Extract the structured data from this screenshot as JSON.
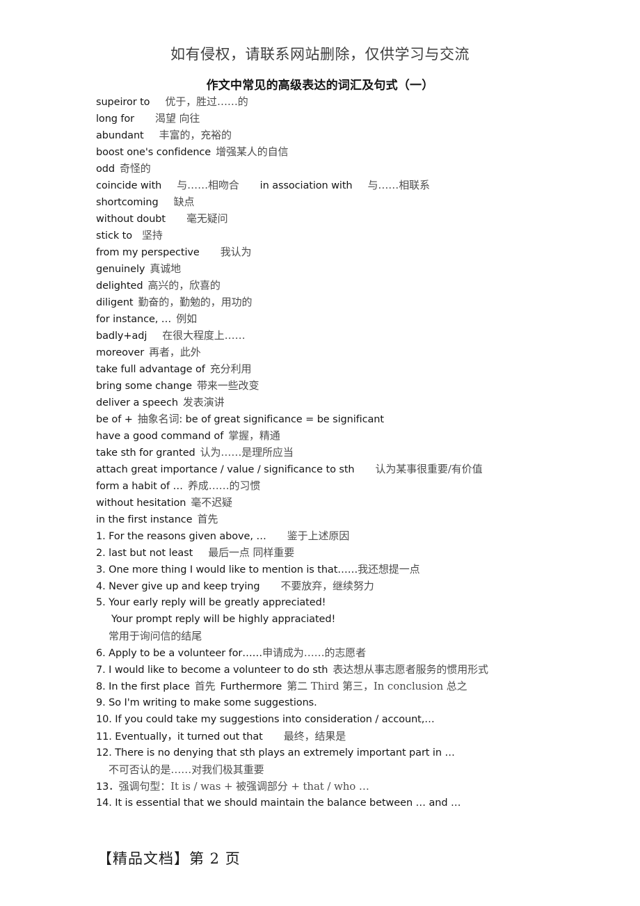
{
  "header": {
    "watermark": "如有侵权，请联系网站删除，仅供学习与交流",
    "title": "作文中常见的高级表达的词汇及句式（一）"
  },
  "footer": {
    "text": "【精品文档】第 2 页",
    "page_number": "2"
  },
  "lines": [
    {
      "en": "supeiror to",
      "gap": "sp3",
      "cn": "优于，胜过……的"
    },
    {
      "en": "long for",
      "gap": "sp4",
      "cn": "渴望   向往"
    },
    {
      "en": "abundant",
      "gap": "sp3",
      "cn": "丰富的，充裕的"
    },
    {
      "en": "boost one's confidence",
      "gap": "sp1",
      "cn": "增强某人的自信"
    },
    {
      "en": "odd",
      "gap": "sp1",
      "cn": "奇怪的"
    },
    {
      "en": "coincide with",
      "gap": "sp3",
      "cn": "与……相吻合",
      "en2": "in association with",
      "gap2": "sp3",
      "cn2": "与……相联系",
      "gapmid": "sp4"
    },
    {
      "en": "shortcoming",
      "gap": "sp3",
      "cn": "缺点"
    },
    {
      "en": "without doubt",
      "gap": "sp4",
      "cn": "毫无疑问"
    },
    {
      "en": "stick   to",
      "gap": "sp2",
      "cn": "坚持"
    },
    {
      "en": "from   my   perspective",
      "gap": "sp4",
      "cn": "我认为"
    },
    {
      "en": "genuinely",
      "gap": "sp1",
      "cn": "真诚地"
    },
    {
      "en": "delighted",
      "gap": "sp1",
      "cn": "高兴的，欣喜的"
    },
    {
      "en": "diligent",
      "gap": "sp1",
      "cn": "勤奋的，勤勉的，用功的"
    },
    {
      "en": "for   instance, …",
      "gap": "sp1",
      "cn": "例如"
    },
    {
      "en": "badly+adj",
      "gap": "sp3",
      "cn": "在很大程度上……"
    },
    {
      "en": "moreover",
      "gap": "sp1",
      "cn": "再者，此外"
    },
    {
      "en": "take   full   advantage   of",
      "gap": "sp1",
      "cn": "充分利用"
    },
    {
      "en": "bring some change",
      "gap": "sp1",
      "cn": "带来一些改变"
    },
    {
      "en": "deliver a speech",
      "gap": "sp1",
      "cn": "发表演讲"
    },
    {
      "en": "be of +",
      "gap": "sp1",
      "cn": "抽象名词",
      "en2": ": be of great significance = be significant",
      "gap2": "",
      "cn2": "",
      "gapmid": ""
    },
    {
      "en": "have a good command of",
      "gap": "sp1",
      "cn": "掌握，精通"
    },
    {
      "en": "take sth for granted",
      "gap": "sp1",
      "cn": "认为……是理所应当"
    },
    {
      "en": "attach great importance / value / significance to sth",
      "gap": "sp4",
      "cn": "认为某事很重要/有价值"
    },
    {
      "en": "form a habit of …",
      "gap": "sp1",
      "cn": "养成……的习惯"
    },
    {
      "en": "without hesitation",
      "gap": "sp1",
      "cn": "毫不迟疑"
    },
    {
      "en": "in the first instance",
      "gap": "sp1",
      "cn": "首先"
    },
    {
      "en": "1. For the reasons given above, …",
      "gap": "sp4",
      "cn": "鉴于上述原因"
    },
    {
      "en": "2. last but not least",
      "gap": "sp3",
      "cn": "最后一点 同样重要"
    },
    {
      "en": "3. One more thing I would like to mention is that……",
      "gap": "",
      "cn": "我还想提一点"
    },
    {
      "en": "4. Never give up and keep trying",
      "gap": "sp4",
      "cn": "不要放弃，继续努力"
    },
    {
      "en": "5. Your early reply will be greatly appreciated!",
      "gap": "",
      "cn": ""
    },
    {
      "en": "Your prompt reply will be highly appraciated!",
      "gap": "",
      "cn": "",
      "indent": "indent"
    },
    {
      "en": "",
      "gap": "",
      "cn": "常用于询问信的结尾",
      "indent": "indent-sm"
    },
    {
      "en": "6. Apply to be a volunteer for……",
      "gap": "",
      "cn": "申请成为……的志愿者"
    },
    {
      "en": "7. I would like to become a volunteer to do sth",
      "gap": "sp1",
      "cn": "表达想从事志愿者服务的惯用形式"
    },
    {
      "en": "8. In the first place",
      "gap": "sp1",
      "cn": "首先",
      "en2": "Furthermore",
      "gap2": "sp1",
      "cn2": "第二 Third  第三，In conclusion  总之",
      "gapmid": "sp1"
    },
    {
      "en": "9. So I'm writing to make some suggestions.",
      "gap": "",
      "cn": ""
    },
    {
      "en": "10. If you could take my suggestions into consideration / account,…",
      "gap": "",
      "cn": ""
    },
    {
      "en": "11. Eventually，it turned out that",
      "gap": "sp4",
      "cn": "最终，结果是"
    },
    {
      "en": "12. There is no denying that sth plays an extremely important part in …",
      "gap": "",
      "cn": ""
    },
    {
      "en": "",
      "gap": "",
      "cn": "不可否认的是……对我们极其重要",
      "indent": "indent-sm"
    },
    {
      "en": "13．",
      "gap": "",
      "cn": "强调句型：It is / was + 被强调部分 + that / who …"
    },
    {
      "en": "14. It is essential that we should maintain the balance between … and …",
      "gap": "",
      "cn": ""
    }
  ]
}
